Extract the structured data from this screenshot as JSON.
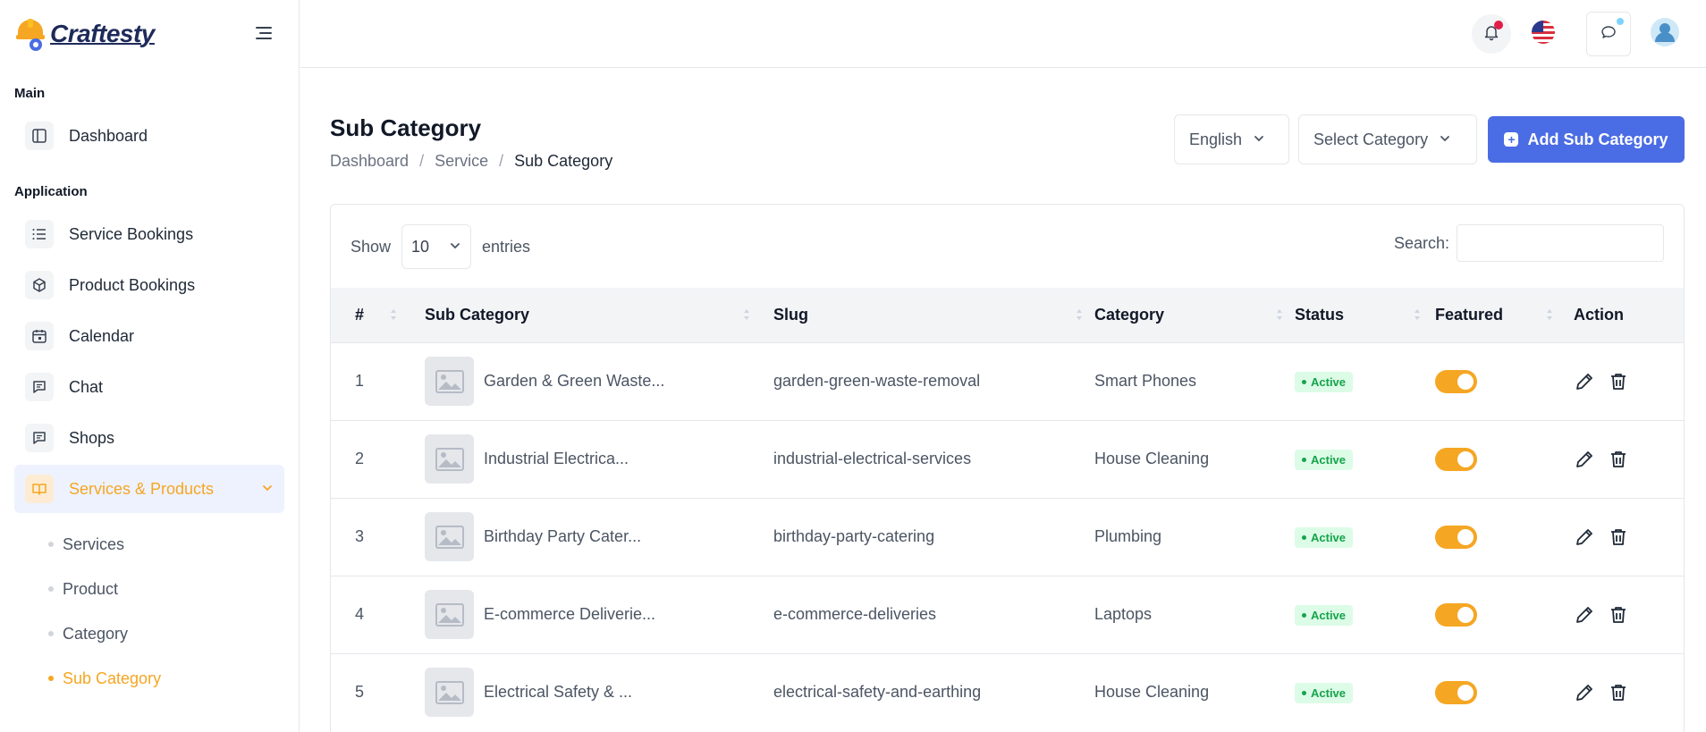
{
  "app": {
    "name": "Craftesty"
  },
  "sidebar": {
    "section_main": "Main",
    "section_application": "Application",
    "items": [
      {
        "label": "Dashboard",
        "icon": "layout-icon"
      },
      {
        "label": "Service Bookings",
        "icon": "list-icon"
      },
      {
        "label": "Product Bookings",
        "icon": "box-icon"
      },
      {
        "label": "Calendar",
        "icon": "calendar-icon"
      },
      {
        "label": "Chat",
        "icon": "chat-icon"
      },
      {
        "label": "Shops",
        "icon": "chat-icon"
      },
      {
        "label": "Services & Products",
        "icon": "book-icon",
        "active": true
      }
    ],
    "sub_items": [
      {
        "label": "Services"
      },
      {
        "label": "Product"
      },
      {
        "label": "Category"
      },
      {
        "label": "Sub Category",
        "active": true
      }
    ]
  },
  "header": {
    "title": "Sub Category",
    "breadcrumb": [
      "Dashboard",
      "Service",
      "Sub Category"
    ],
    "language_select": "English",
    "category_select": "Select Category",
    "add_button": "Add Sub Category"
  },
  "table_controls": {
    "show_label": "Show",
    "page_length": "10",
    "entries_label": "entries",
    "search_label": "Search:",
    "search_value": ""
  },
  "table": {
    "columns": [
      "#",
      "Sub Category",
      "Slug",
      "Category",
      "Status",
      "Featured",
      "Action"
    ],
    "rows": [
      {
        "num": "1",
        "name": "Garden & Green Waste...",
        "slug": "garden-green-waste-removal",
        "category": "Smart Phones",
        "status": "Active",
        "featured": true
      },
      {
        "num": "2",
        "name": "Industrial Electrica...",
        "slug": "industrial-electrical-services",
        "category": "House Cleaning",
        "status": "Active",
        "featured": true
      },
      {
        "num": "3",
        "name": "Birthday Party Cater...",
        "slug": "birthday-party-catering",
        "category": "Plumbing",
        "status": "Active",
        "featured": true
      },
      {
        "num": "4",
        "name": "E-commerce Deliverie...",
        "slug": "e-commerce-deliveries",
        "category": "Laptops",
        "status": "Active",
        "featured": true
      },
      {
        "num": "5",
        "name": "Electrical Safety & ...",
        "slug": "electrical-safety-and-earthing",
        "category": "House Cleaning",
        "status": "Active",
        "featured": true
      }
    ]
  },
  "colors": {
    "accent": "#f5a623",
    "primary": "#4a6ce4",
    "status_active": "#16a34a"
  }
}
